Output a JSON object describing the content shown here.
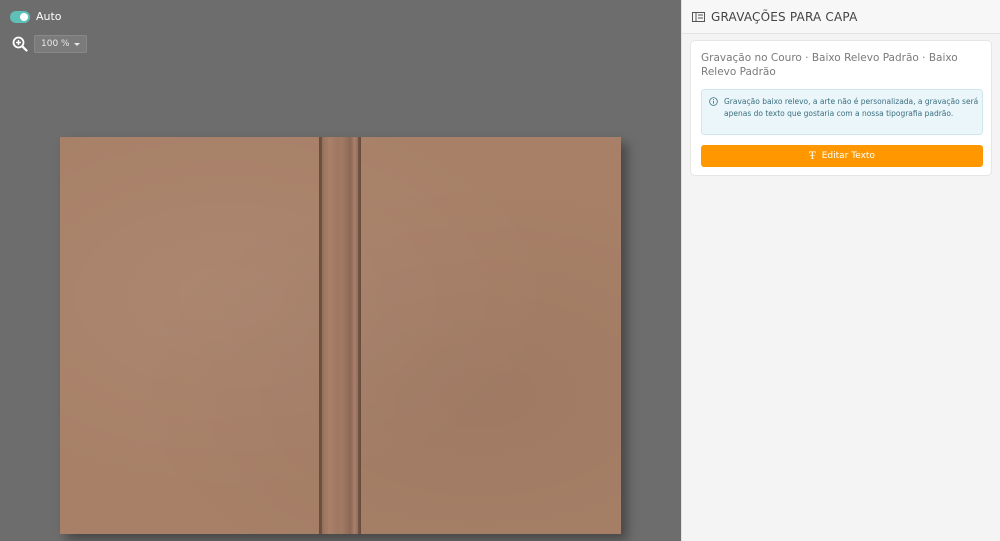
{
  "canvas": {
    "auto_label": "Auto",
    "zoom_value": "100 %",
    "colors": {
      "background": "#6d6d6d",
      "cover": "#a88068",
      "toggle": "#5ec0b7"
    }
  },
  "panel": {
    "title": "GRAVAÇÕES PARA CAPA",
    "card": {
      "title": "Gravação no Couro · Baixo Relevo Padrão · Baixo Relevo Padrão",
      "info": "Gravação baixo relevo, a arte não é personalizada, a gravação será apenas do texto que gostaria com a nossa tipografia padrão.",
      "button_label": "Editar Texto",
      "button_color": "#ff9800"
    }
  }
}
